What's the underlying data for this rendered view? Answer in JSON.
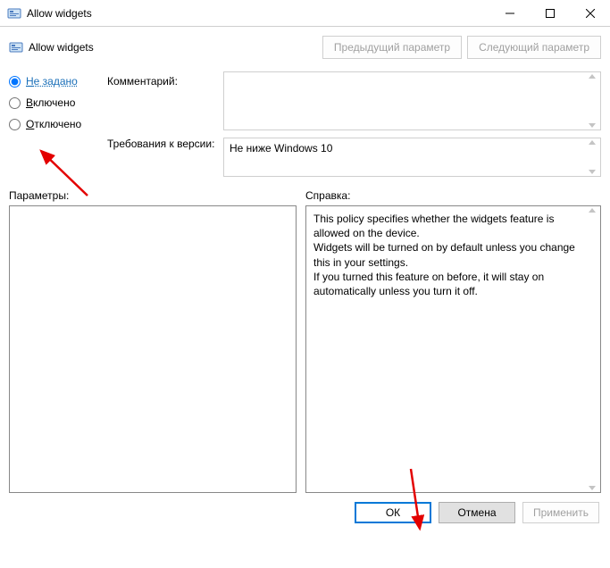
{
  "window": {
    "title": "Allow widgets"
  },
  "header": {
    "policy_title": "Allow widgets",
    "prev_button": "Предыдущий параметр",
    "next_button": "Следующий параметр"
  },
  "state_options": {
    "not_configured": {
      "first": "Н",
      "rest": "е задано",
      "selected": true
    },
    "enabled": {
      "first": "В",
      "rest": "ключено",
      "selected": false
    },
    "disabled": {
      "first": "О",
      "rest": "тключено",
      "selected": false
    }
  },
  "labels": {
    "comment": "Комментарий:",
    "requirements": "Требования к версии:",
    "parameters": "Параметры:",
    "help": "Справка:"
  },
  "fields": {
    "comment_value": "",
    "requirements_value": "Не ниже Windows 10"
  },
  "help_text": "This policy specifies whether the widgets feature is allowed on the device.\nWidgets will be turned on by default unless you change this in your settings.\nIf you turned this feature on before, it will stay on automatically unless you turn it off.",
  "footer": {
    "ok": "ОК",
    "cancel": "Отмена",
    "apply": "Применить"
  }
}
